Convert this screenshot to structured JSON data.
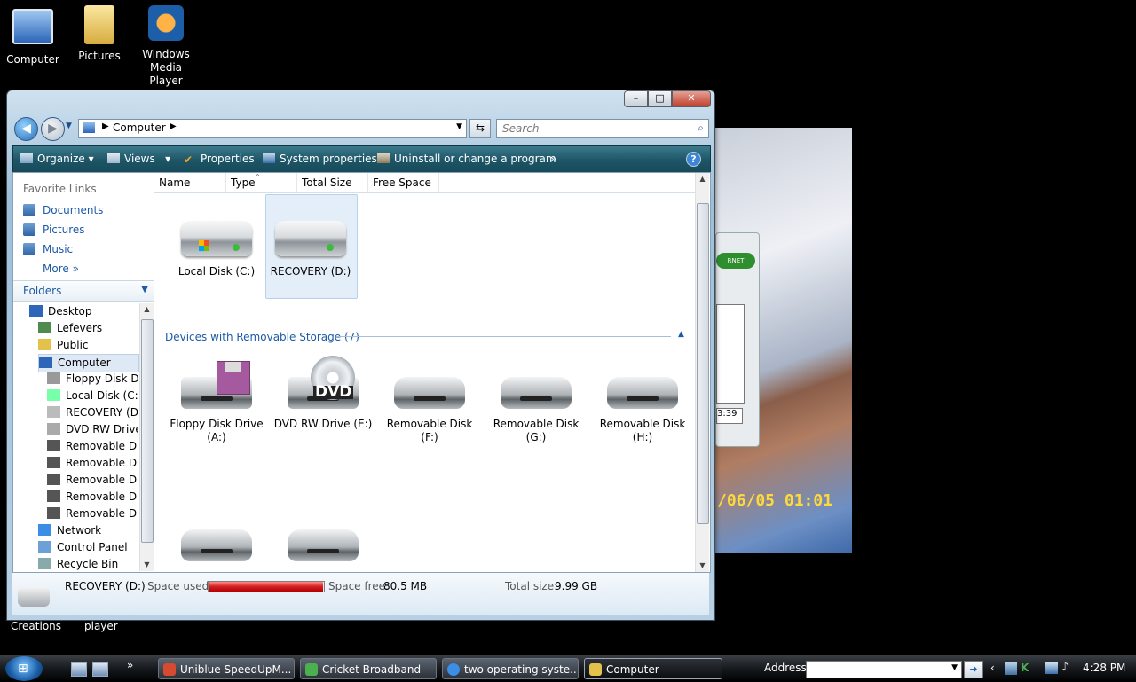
{
  "desktop": {
    "icons": [
      {
        "label": "Computer"
      },
      {
        "label": "Pictures"
      },
      {
        "label": "Windows Media Player"
      }
    ],
    "bottom_labels": [
      "Creations",
      "player"
    ],
    "photo_timestamp": "/06/05 01:01",
    "widget_pill": "RNET",
    "widget_time": "3:39"
  },
  "window": {
    "caption_buttons": {
      "minimize": "–",
      "maximize": "□",
      "close": "✕"
    },
    "nav": {
      "back": "◀",
      "forward": "▶",
      "breadcrumb": "Computer",
      "search_placeholder": "Search",
      "refresh": "⇆"
    },
    "toolbar": {
      "organize": "Organize",
      "views": "Views",
      "properties": "Properties",
      "system_properties": "System properties",
      "uninstall": "Uninstall or change a program",
      "more": "»",
      "help": "?"
    },
    "favorite_links": {
      "title": "Favorite Links",
      "items": [
        "Documents",
        "Pictures",
        "Music",
        "More »"
      ]
    },
    "folders": {
      "title": "Folders",
      "tree": [
        "Desktop",
        "Lefevers",
        "Public",
        "Computer",
        "Floppy Disk Dr",
        "Local Disk (C:)",
        "RECOVERY (D:)",
        "DVD RW Drive",
        "Removable Dis",
        "Removable Dis",
        "Removable Dis",
        "Removable Dis",
        "Removable Dis",
        "Network",
        "Control Panel",
        "Recycle Bin"
      ]
    },
    "columns": [
      "Name",
      "Type",
      "Total Size",
      "Free Space"
    ],
    "hard_disks": [
      {
        "label": "Local Disk (C:)"
      },
      {
        "label": "RECOVERY (D:)"
      }
    ],
    "removable_group": "Devices with Removable Storage (7)",
    "removable": [
      {
        "label": "Floppy Disk Drive (A:)"
      },
      {
        "label": "DVD RW Drive (E:)"
      },
      {
        "label": "Removable Disk (F:)"
      },
      {
        "label": "Removable Disk (G:)"
      },
      {
        "label": "Removable Disk (H:)"
      }
    ],
    "dvd_text": "DVD",
    "details": {
      "name": "RECOVERY (D:)",
      "space_used_label": "Space used:",
      "space_used_fraction": 0.99,
      "space_free_label": "Space free:",
      "space_free": "80.5 MB",
      "total_size_label": "Total size:",
      "total_size": "9.99 GB"
    }
  },
  "taskbar": {
    "quick_launch_more": "»",
    "tasks": [
      {
        "label": "Uniblue SpeedUpM..."
      },
      {
        "label": "Cricket Broadband"
      },
      {
        "label": "two operating syste..."
      },
      {
        "label": "Computer"
      }
    ],
    "address_label": "Address",
    "tray_chevron": "‹",
    "clock": "4:28 PM"
  }
}
